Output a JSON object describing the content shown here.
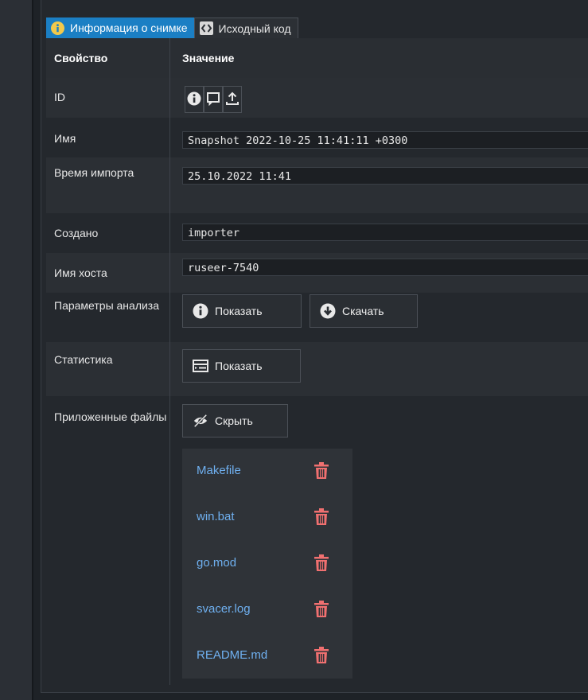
{
  "tabs": [
    {
      "label": "Информация о снимке",
      "icon": "info-circle-icon",
      "active": true
    },
    {
      "label": "Исходный код",
      "icon": "code-icon",
      "active": false
    }
  ],
  "table": {
    "header": {
      "property": "Свойство",
      "value": "Значение"
    },
    "rows": {
      "id": {
        "label": "ID",
        "icons": [
          "info-icon",
          "comment-icon",
          "upload-icon"
        ]
      },
      "name": {
        "label": "Имя",
        "value": "Snapshot 2022-10-25 11:41:11 +0300"
      },
      "import_time": {
        "label": "Время импорта",
        "value": "25.10.2022 11:41"
      },
      "created": {
        "label": "Создано",
        "value": "importer"
      },
      "hostname": {
        "label": "Имя хоста",
        "value": "ruseer-7540"
      },
      "analysis_params": {
        "label": "Параметры анализа",
        "show_label": "Показать",
        "download_label": "Скачать"
      },
      "statistics": {
        "label": "Статистика",
        "show_label": "Показать"
      },
      "attached_files": {
        "label": "Приложенные файлы",
        "hide_label": "Скрыть",
        "files": [
          "Makefile",
          "win.bat",
          "go.mod",
          "svacer.log",
          "README.md"
        ]
      }
    }
  },
  "colors": {
    "accent": "#1b7fc4",
    "link": "#6fb0f0",
    "delete": "#f07070",
    "background": "#24282d"
  }
}
